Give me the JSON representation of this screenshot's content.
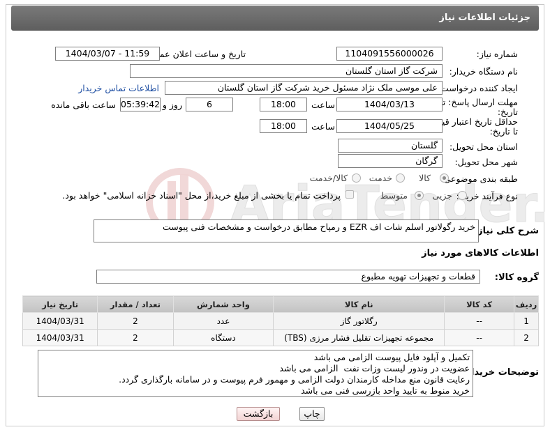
{
  "header": {
    "title": "جزئیات اطلاعات نیاز"
  },
  "fields": {
    "need_number_label": "شماره نیاز:",
    "need_number": "1104091556000026",
    "announce_label": "تاریخ و ساعت اعلان عمومی:",
    "announce_value": "1404/03/07 - 11:59",
    "buyer_org_label": "نام دستگاه خریدار:",
    "buyer_org": "شرکت گاز استان گلستان",
    "creator_label": "ایجاد کننده درخواست:",
    "creator": "علی موسی ملک نژاد مسئول خرید شرکت گاز استان گلستان",
    "contact_link": "اطلاعات تماس خریدار",
    "reply_deadline_label_1": "مهلت ارسال پاسخ: تا",
    "reply_deadline_label_2": "تاریخ:",
    "reply_date": "1404/03/13",
    "time_label": "ساعت",
    "reply_time": "18:00",
    "days_value": "6",
    "days_label": "روز و",
    "remaining_time": "05:39:42",
    "remaining_label": "ساعت باقی مانده",
    "price_deadline_label_1": "حداقل تاریخ اعتبار قیمت:",
    "price_deadline_label_2": "تا تاریخ:",
    "price_date": "1404/05/25",
    "price_time": "18:00",
    "province_label": "استان محل تحویل:",
    "province": "گلستان",
    "city_label": "شهر محل تحویل:",
    "city": "گرگان",
    "category_label": "طبقه بندی موضوعی:",
    "category_options": [
      "کالا",
      "خدمت",
      "کالا/خدمت"
    ],
    "purchase_type_label": "نوع فرآیند خرید :",
    "purchase_options": [
      "جزیی",
      "متوسط"
    ],
    "payment_note": "پرداخت تمام یا بخشی از مبلغ خرید،از محل \"اسناد خزانه اسلامی\" خواهد بود.",
    "summary_label": "شرح کلی نیاز:",
    "summary": "خرید رگولاتور اسلم شات اف EZR و رمپاح مطابق درخواست و مشخصات فنی پیوست",
    "goods_info_title": "اطلاعات کالاهای مورد نیاز",
    "goods_group_label": "گروه کالا:",
    "goods_group": "قطعات و تجهیزات تهویه مطبوع"
  },
  "table": {
    "headers": [
      "ردیف",
      "کد کالا",
      "نام کالا",
      "واحد شمارش",
      "تعداد / مقدار",
      "تاریخ نیاز"
    ],
    "rows": [
      [
        "1",
        "--",
        "رگلاتور گاز",
        "عدد",
        "2",
        "1404/03/31"
      ],
      [
        "2",
        "--",
        "مجموعه تجهیزات تقلیل فشار مرزی (TBS)",
        "دستگاه",
        "2",
        "1404/03/31"
      ]
    ]
  },
  "notes": {
    "label": "توضیحات خریدار:",
    "text": "تکمیل و آپلود فایل پیوست الزامی می باشد\nعضویت در وندور لیست وزات نفت  الزامی می باشد\nرعایت قانون منع مداخله کارمندان دولت الزامی و مهمور فرم پیوست و در سامانه بارگذاری گردد.\nخرید منوط به تایید واحد بازرسی فنی می باشد"
  },
  "buttons": {
    "print": "چاپ",
    "back": "بازگشت"
  },
  "colors": {
    "header_bg": "#6b6b6b",
    "link": "#1f4fa3",
    "back_button": "#f2d3d3"
  }
}
